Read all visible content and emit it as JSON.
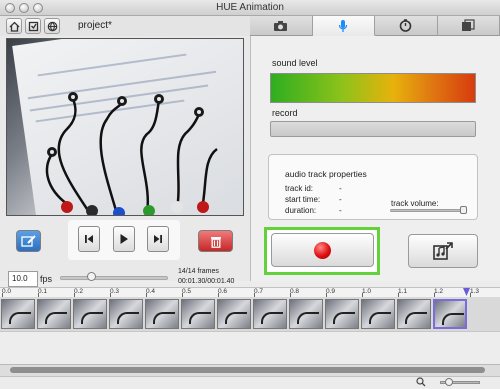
{
  "window": {
    "title": "HUE Animation"
  },
  "toolbar": {
    "project_name": "project*"
  },
  "tabs": [
    {
      "icon": "camera-icon",
      "active": false
    },
    {
      "icon": "microphone-icon",
      "active": true
    },
    {
      "icon": "timer-icon",
      "active": false
    },
    {
      "icon": "film-gallery-icon",
      "active": false
    }
  ],
  "audio": {
    "sound_level_label": "sound level",
    "record_label": "record",
    "properties_title": "audio track properties",
    "track_id_label": "track id:",
    "track_id_value": "-",
    "start_time_label": "start time:",
    "start_time_value": "-",
    "duration_label": "duration:",
    "duration_value": "-",
    "track_volume_label": "track volume:",
    "track_volume_value": 0.95
  },
  "playback": {
    "fps_value": "10.0",
    "fps_label": "fps",
    "frames_text": "14/14 frames",
    "time_text": "00:01.30/00:01.40",
    "speed_value": 0.3
  },
  "timeline": {
    "ticks": [
      "0.0",
      "0.1",
      "0.2",
      "0.3",
      "0.4",
      "0.5",
      "0.6",
      "0.7",
      "0.8",
      "0.9",
      "1.0",
      "1.1",
      "1.2",
      "1.3"
    ],
    "frame_count": 13,
    "selected_frame": 13
  },
  "colors": {
    "record_highlight": "#63d13c",
    "record_dot": "#e01010",
    "tab_active": "#1a8cff",
    "edit_button": "#2c6ec0",
    "delete_button": "#c42828",
    "playhead": "#6b5ad9"
  }
}
